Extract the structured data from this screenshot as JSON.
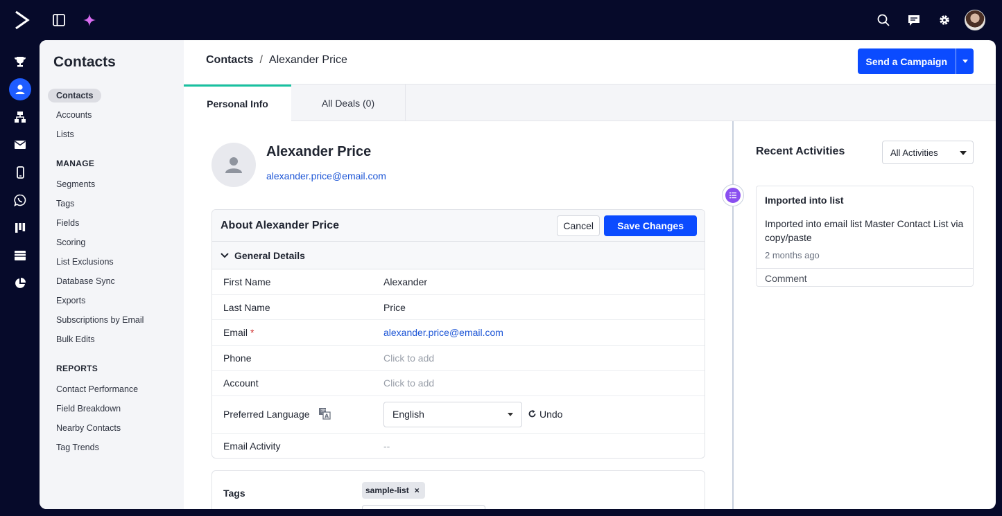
{
  "colors": {
    "accent": "#0b4bff",
    "tab_active": "#18c2a0",
    "rail_active": "#1e5cff",
    "activity_icon": "#8a4ff0"
  },
  "sidebar": {
    "title": "Contacts",
    "items": [
      "Contacts",
      "Accounts",
      "Lists"
    ],
    "manage_heading": "MANAGE",
    "manage": [
      "Segments",
      "Tags",
      "Fields",
      "Scoring",
      "List Exclusions",
      "Database Sync",
      "Exports",
      "Subscriptions by Email",
      "Bulk Edits"
    ],
    "reports_heading": "REPORTS",
    "reports": [
      "Contact Performance",
      "Field Breakdown",
      "Nearby Contacts",
      "Tag Trends"
    ]
  },
  "breadcrumb": {
    "root": "Contacts",
    "sep": "/",
    "current": "Alexander Price"
  },
  "send_campaign": "Send a Campaign",
  "tabs": [
    "Personal Info",
    "All Deals (0)"
  ],
  "profile": {
    "name": "Alexander Price",
    "email": "alexander.price@email.com"
  },
  "about": {
    "title": "About Alexander Price",
    "cancel": "Cancel",
    "save": "Save Changes",
    "section": "General Details",
    "fields": {
      "first_name": {
        "label": "First Name",
        "value": "Alexander"
      },
      "last_name": {
        "label": "Last Name",
        "value": "Price"
      },
      "email": {
        "label": "Email",
        "required": "*",
        "value": "alexander.price@email.com"
      },
      "phone": {
        "label": "Phone",
        "value": "Click to add"
      },
      "account": {
        "label": "Account",
        "value": "Click to add"
      },
      "language": {
        "label": "Preferred Language",
        "value": "English",
        "undo": "Undo"
      },
      "email_activity": {
        "label": "Email Activity",
        "value": "--"
      }
    }
  },
  "tags": {
    "label": "Tags",
    "chips": [
      "sample-list"
    ],
    "remove": "×"
  },
  "recent": {
    "title": "Recent Activities",
    "filter": "All Activities",
    "items": [
      {
        "title": "Imported into list",
        "body": "Imported into email list Master Contact List via copy/paste",
        "time": "2 months ago",
        "comment": "Comment"
      }
    ]
  },
  "icons": {
    "logo": "activecampaign-chevron-icon",
    "topbar": [
      "sidebar-toggle-icon",
      "sparkle-icon",
      "search-icon",
      "chat-icon",
      "gear-icon"
    ],
    "rail": [
      "trophy-icon",
      "contact-icon",
      "sitemap-icon",
      "mail-icon",
      "mobile-icon",
      "whatsapp-icon",
      "pipeline-icon",
      "site-icon",
      "pie-chart-icon"
    ]
  }
}
